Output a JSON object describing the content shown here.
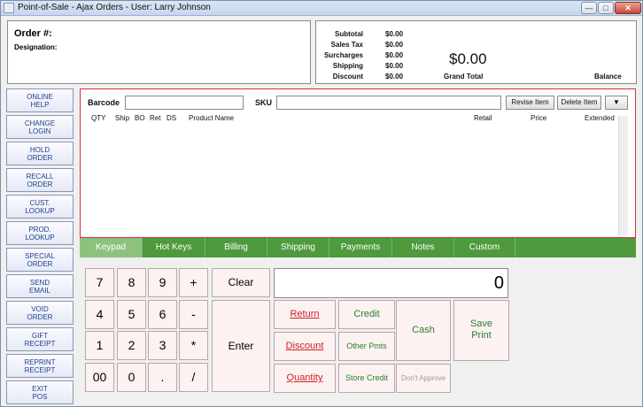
{
  "window": {
    "title": "Point-of-Sale - Ajax Orders - User: Larry Johnson",
    "min_symbol": "—",
    "max_symbol": "□",
    "close_symbol": "✕"
  },
  "order": {
    "order_label": "Order #:",
    "designation_label": "Designation:"
  },
  "totals": {
    "rows": [
      {
        "label": "Subtotal",
        "value": "$0.00"
      },
      {
        "label": "Sales Tax",
        "value": "$0.00"
      },
      {
        "label": "Surcharges",
        "value": "$0.00"
      },
      {
        "label": "Shipping",
        "value": "$0.00"
      },
      {
        "label": "Discount",
        "value": "$0.00"
      }
    ],
    "grand_total_amount": "$0.00",
    "grand_total_label": "Grand Total",
    "balance_label": "Balance"
  },
  "sidebar": {
    "items": [
      "ONLINE\nHELP",
      "CHANGE\nLOGIN",
      "HOLD\nORDER",
      "RECALL\nORDER",
      "CUST.\nLOOKUP",
      "PROD.\nLOOKUP",
      "SPECIAL\nORDER",
      "SEND\nEMAIL",
      "VOID\nORDER",
      "GIFT\nRECEIPT",
      "REPRINT\nRECEIPT",
      "EXIT\nPOS"
    ]
  },
  "entry": {
    "barcode_label": "Barcode",
    "barcode_value": "",
    "sku_label": "SKU",
    "sku_value": "",
    "revise_item": "Revise Item",
    "delete_item": "Delete Item",
    "dropdown_symbol": "▼",
    "columns": [
      "QTY",
      "Ship",
      "BO",
      "Ret",
      "DS",
      "Product Name",
      "Retail",
      "Price",
      "Extended"
    ]
  },
  "tabs": [
    "Keypad",
    "Hot Keys",
    "Billing",
    "Shipping",
    "Payments",
    "Notes",
    "Custom"
  ],
  "active_tab": "Keypad",
  "keypad": {
    "keys": [
      "7",
      "8",
      "9",
      "+",
      "4",
      "5",
      "6",
      "-",
      "1",
      "2",
      "3",
      "*",
      "00",
      "0",
      ".",
      "/"
    ],
    "clear": "Clear",
    "enter": "Enter",
    "display": "0"
  },
  "actions": {
    "return": "Return",
    "credit": "Credit",
    "cash": "Cash",
    "save_print": "Save\nPrint",
    "discount": "Discount",
    "other_pmts": "Other Pmts",
    "quantity": "Quantity",
    "store_credit": "Store Credit",
    "dont_approve": "Don't Approve"
  },
  "colors": {
    "tab_green": "#4e9a3d",
    "tab_active": "#8cc27e",
    "entry_border": "#d7303a",
    "sidebar_text": "#1d3f8f",
    "action_red": "#cf1f27",
    "action_green": "#2c7d2d"
  }
}
